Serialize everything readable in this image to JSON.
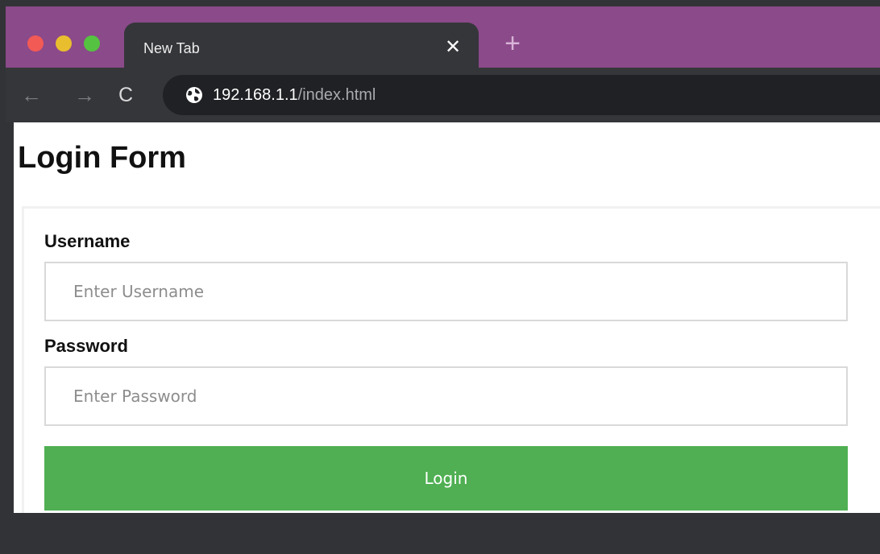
{
  "browser": {
    "tab": {
      "title": "New Tab",
      "close_icon": "close-icon",
      "close_glyph": "✕"
    },
    "new_tab_glyph": "+",
    "traffic_lights": [
      {
        "name": "close",
        "color": "#F25A56"
      },
      {
        "name": "minimize",
        "color": "#E9BE2E"
      },
      {
        "name": "maximize",
        "color": "#55C241"
      }
    ],
    "toolbar": {
      "back_glyph": "←",
      "forward_glyph": "→",
      "reload_glyph": "C"
    },
    "address": {
      "host": "192.168.1.1",
      "path": "/index.html",
      "icon": "globe-icon"
    },
    "colors": {
      "tabstrip": "#8B4A8A",
      "toolbar": "#35363A",
      "omnibox": "#202124"
    }
  },
  "page": {
    "title": "Login Form",
    "form": {
      "username_label": "Username",
      "username_placeholder": "Enter Username",
      "username_value": "",
      "password_label": "Password",
      "password_placeholder": "Enter Password",
      "password_value": "",
      "login_label": "Login"
    },
    "colors": {
      "login_button": "#4FAF52"
    }
  }
}
